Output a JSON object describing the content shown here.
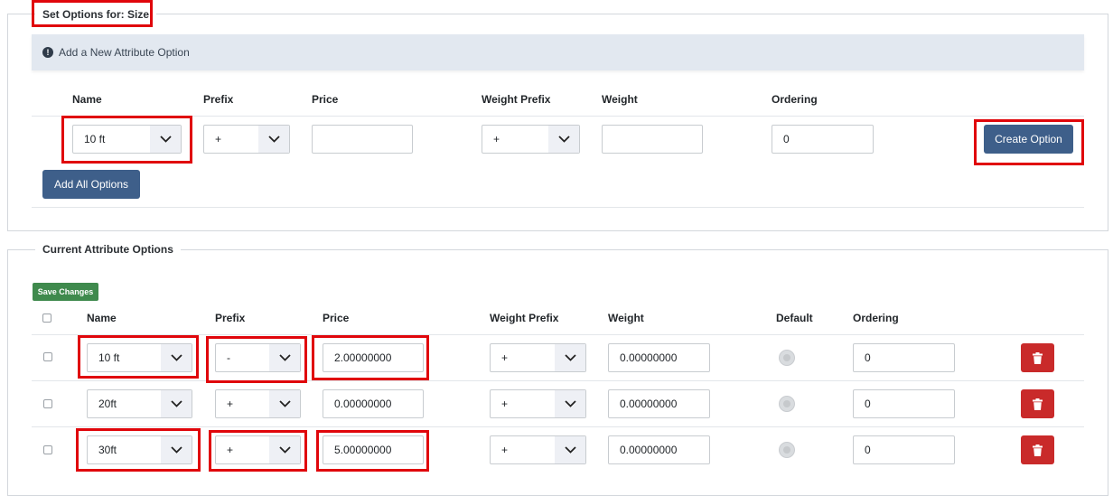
{
  "set_options": {
    "legend": "Set Options for: Size",
    "info_text": "Add a New Attribute Option",
    "headers": {
      "name": "Name",
      "prefix": "Prefix",
      "price": "Price",
      "weight_prefix": "Weight Prefix",
      "weight": "Weight",
      "ordering": "Ordering"
    },
    "new_option": {
      "name": "10 ft",
      "prefix": "+",
      "price": "",
      "weight_prefix": "+",
      "weight": "",
      "ordering": "0"
    },
    "create_button": "Create Option",
    "add_all_button": "Add All Options"
  },
  "current_options": {
    "legend": "Current Attribute Options",
    "save_button": "Save Changes",
    "headers": {
      "name": "Name",
      "prefix": "Prefix",
      "price": "Price",
      "weight_prefix": "Weight Prefix",
      "weight": "Weight",
      "default": "Default",
      "ordering": "Ordering"
    },
    "rows": [
      {
        "name": "10 ft",
        "prefix": "-",
        "price": "2.00000000",
        "weight_prefix": "+",
        "weight": "0.00000000",
        "ordering": "0"
      },
      {
        "name": "20ft",
        "prefix": "+",
        "price": "0.00000000",
        "weight_prefix": "+",
        "weight": "0.00000000",
        "ordering": "0"
      },
      {
        "name": "30ft",
        "prefix": "+",
        "price": "5.00000000",
        "weight_prefix": "+",
        "weight": "0.00000000",
        "ordering": "0"
      }
    ]
  },
  "colors": {
    "primary_button": "#3e5f8a",
    "save_button": "#3f8a4d",
    "delete_button": "#c92a2a",
    "highlight": "#e0060b",
    "info_bar": "#e2e8f0"
  },
  "icons": {
    "info": "info-circle-icon",
    "dropdown": "chevron-down-icon",
    "delete": "trash-icon"
  }
}
